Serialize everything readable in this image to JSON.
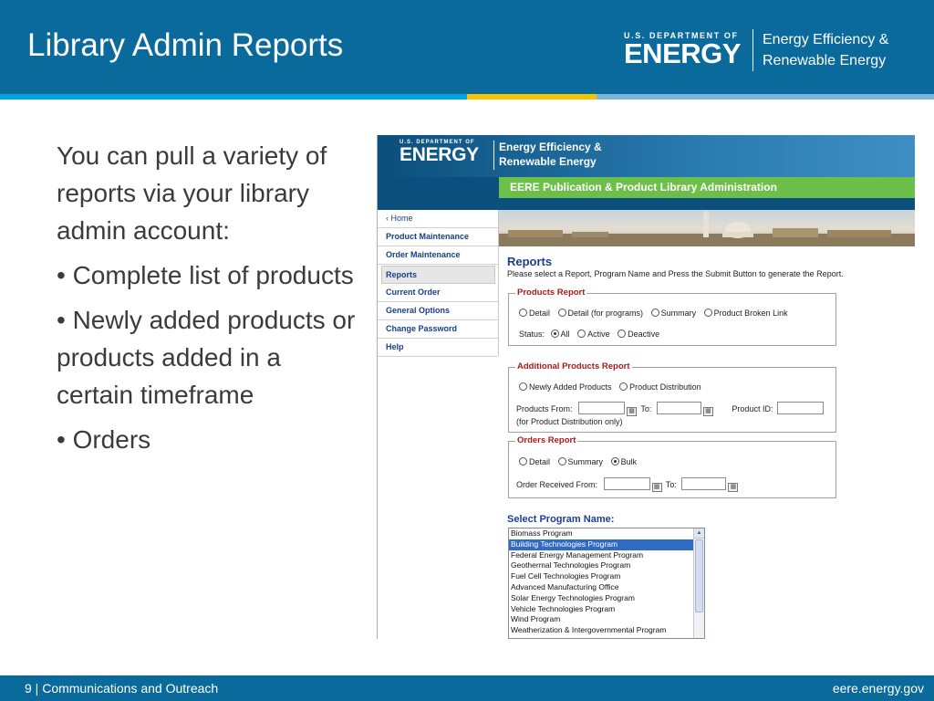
{
  "header": {
    "title": "Library Admin Reports",
    "logo_small": "U.S. DEPARTMENT OF",
    "logo_big": "ENERGY",
    "eere_line1": "Energy Efficiency &",
    "eere_line2": "Renewable Energy"
  },
  "body": {
    "intro": "You can pull a variety of reports via your library admin account:",
    "bullets": [
      "• Complete list of products",
      "• Newly added products or products added in a certain timeframe",
      "• Orders"
    ]
  },
  "screenshot": {
    "logo_small": "U.S. DEPARTMENT OF",
    "logo_big": "ENERGY",
    "eere_line1": "Energy Efficiency &",
    "eere_line2": "Renewable Energy",
    "bar_title": "EERE Publication & Product Library Administration",
    "nav": [
      "‹ Home",
      "Product Maintenance",
      "Order Maintenance",
      "Reports",
      "Current Order",
      "General Options",
      "Change Password",
      "Help"
    ],
    "reports_title": "Reports",
    "instructions": "Please select a Report, Program Name and Press the Submit Button to generate the Report.",
    "products_report": {
      "legend": "Products Report",
      "options": [
        "Detail",
        "Detail (for programs)",
        "Summary",
        "Product Broken Link"
      ],
      "status_label": "Status:",
      "status_options": [
        "All",
        "Active",
        "Deactive"
      ]
    },
    "additional_report": {
      "legend": "Additional Products Report",
      "options": [
        "Newly Added Products",
        "Product Distribution"
      ],
      "from_label": "Products From:",
      "to_label": "To:",
      "id_label": "Product ID:",
      "note": "(for Product Distribution only)"
    },
    "orders_report": {
      "legend": "Orders Report",
      "options": [
        "Detail",
        "Summary",
        "Bulk"
      ],
      "from_label": "Order Received From:",
      "to_label": "To:"
    },
    "program_title": "Select Program Name:",
    "programs": [
      "Biomass Program",
      "Building Technologies Program",
      "Federal Energy Management Program",
      "Geothermal Technologies Program",
      "Fuel Cell Technologies Program",
      "Advanced Manufacturing Office",
      "Solar Energy Technologies Program",
      "Vehicle Technologies Program",
      "Wind Program",
      "Weatherization & Intergovernmental Program"
    ]
  },
  "footer": {
    "left": "9 | Communications and Outreach",
    "right": "eere.energy.gov"
  },
  "colors": {
    "header_blue": "#0a6a9c",
    "accent_cyan": "#00a5e4",
    "accent_yellow": "#f5c400",
    "green_bar": "#6cc04a",
    "legend_red": "#b01818",
    "selected_blue": "#316ac5"
  }
}
